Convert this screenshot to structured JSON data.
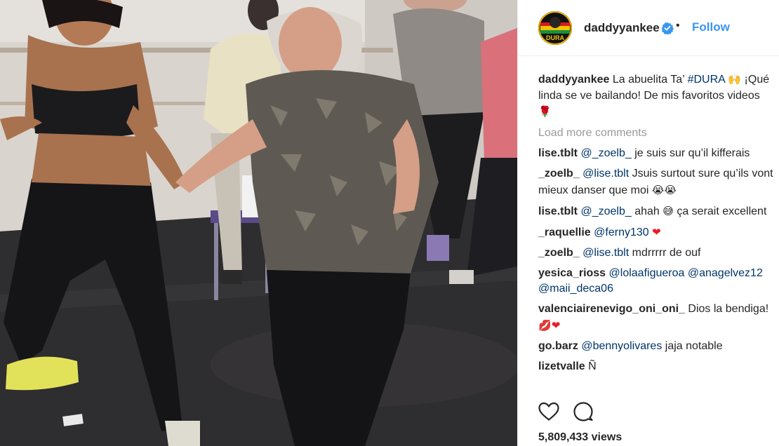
{
  "post": {
    "username": "daddyyankee",
    "verified_icon": "verified-badge-icon",
    "separator": "•",
    "follow_label": "Follow",
    "avatar_text": "DURA",
    "caption_text": "La abuelita Ta’ ",
    "caption_hashtag": "#DURA",
    "caption_emoji": "🙌",
    "caption_line2": "¡Qué linda se ve bailando! De mis favoritos videos ",
    "caption_emoji2": "🌹",
    "load_more": "Load more comments",
    "views": "5,809,433 views"
  },
  "comments": [
    {
      "user": "lise.tblt",
      "parts": [
        {
          "t": "@_zoelb_",
          "m": true
        },
        {
          "t": " je suis sur qu’il kifferais"
        }
      ]
    },
    {
      "user": "_zoelb_",
      "parts": [
        {
          "t": "@lise.tblt",
          "m": true
        },
        {
          "t": " Jsuis surtout sure qu’ils vont mieux danser que moi "
        },
        {
          "t": "😭😭",
          "e": true
        }
      ]
    },
    {
      "user": "lise.tblt",
      "parts": [
        {
          "t": "@_zoelb_",
          "m": true
        },
        {
          "t": " ahah "
        },
        {
          "t": "😅",
          "e": true
        },
        {
          "t": " ça serait excellent"
        }
      ]
    },
    {
      "user": "_raquellie",
      "parts": [
        {
          "t": "@ferny130",
          "m": true
        },
        {
          "t": " "
        },
        {
          "t": "❤",
          "e": true,
          "c": "heart"
        }
      ]
    },
    {
      "user": "_zoelb_",
      "parts": [
        {
          "t": "@lise.tblt",
          "m": true
        },
        {
          "t": " mdrrrrr de ouf"
        }
      ]
    },
    {
      "user": "yesica_rioss",
      "parts": [
        {
          "t": "@lolaafigueroa",
          "m": true
        },
        {
          "t": " "
        },
        {
          "t": "@anagelvez12",
          "m": true
        },
        {
          "t": " "
        },
        {
          "t": "@maii_deca06",
          "m": true
        }
      ]
    },
    {
      "user": "valenciairenevigo_oni_oni_",
      "parts": [
        {
          "t": " Dios la bendiga! "
        },
        {
          "t": "💋",
          "e": true,
          "c": "lips"
        },
        {
          "t": "❤",
          "e": true,
          "c": "heart"
        }
      ]
    },
    {
      "user": "go.barz",
      "parts": [
        {
          "t": "@bennyolivares",
          "m": true
        },
        {
          "t": " jaja notable"
        }
      ]
    },
    {
      "user": "lizetvalle",
      "parts": [
        {
          "t": " Ñ"
        }
      ]
    }
  ],
  "actions": {
    "like_icon": "heart-outline-icon",
    "comment_icon": "comment-bubble-icon"
  }
}
